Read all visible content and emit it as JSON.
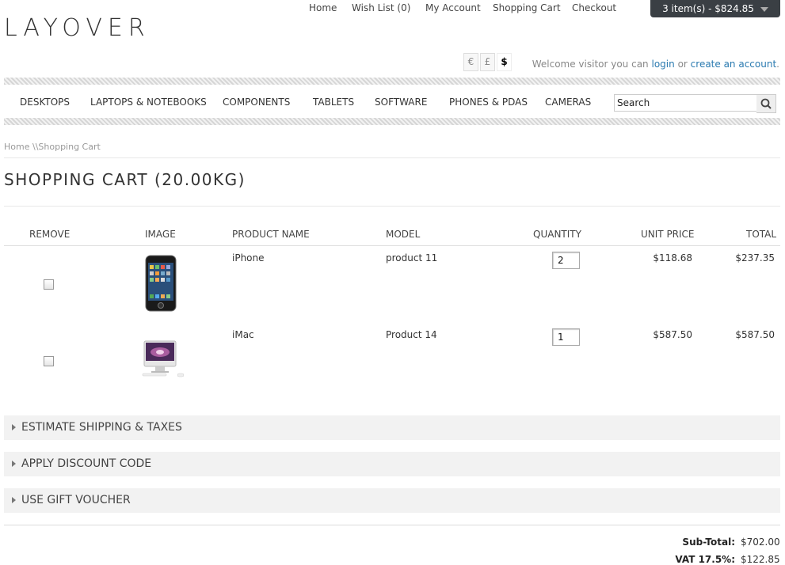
{
  "header": {
    "logo": "LAYOVER",
    "top_links": [
      "Home",
      "Wish List (0)",
      "My Account",
      "Shopping Cart",
      "Checkout"
    ],
    "cart_summary": "3 item(s) - $824.85",
    "currencies": [
      "€",
      "£",
      "$"
    ],
    "active_currency": "$",
    "welcome_prefix": "Welcome visitor you can",
    "login_label": "login",
    "or_label": "or",
    "create_label": "create an account",
    "period": "."
  },
  "nav": {
    "items": [
      "DESKTOPS",
      "LAPTOPS & NOTEBOOKS",
      "COMPONENTS",
      "TABLETS",
      "SOFTWARE",
      "PHONES & PDAS",
      "CAMERAS"
    ],
    "search_value": "Search"
  },
  "breadcrumb": {
    "home": "Home",
    "sep": "\\\\",
    "current": "Shopping Cart"
  },
  "page": {
    "title": "SHOPPING CART  (20.00KG)"
  },
  "table": {
    "headers": {
      "remove": "REMOVE",
      "image": "IMAGE",
      "name": "PRODUCT NAME",
      "model": "MODEL",
      "quantity": "QUANTITY",
      "unit_price": "UNIT PRICE",
      "total": "TOTAL"
    },
    "rows": [
      {
        "name": "iPhone",
        "model": "product 11",
        "quantity": "2",
        "unit_price": "$118.68",
        "total": "$237.35",
        "image_icon": "iphone-image"
      },
      {
        "name": "iMac",
        "model": "Product 14",
        "quantity": "1",
        "unit_price": "$587.50",
        "total": "$587.50",
        "image_icon": "imac-image"
      }
    ]
  },
  "panels": [
    "ESTIMATE SHIPPING & TAXES",
    "APPLY DISCOUNT CODE",
    "USE GIFT VOUCHER"
  ],
  "totals": [
    {
      "label": "Sub-Total:",
      "value": "$702.00"
    },
    {
      "label": "VAT 17.5%:",
      "value": "$122.85"
    }
  ],
  "colors": {
    "link": "#2a7ab0",
    "cart_button": "#3a3f44",
    "panel_bg": "#f2f2f2"
  }
}
